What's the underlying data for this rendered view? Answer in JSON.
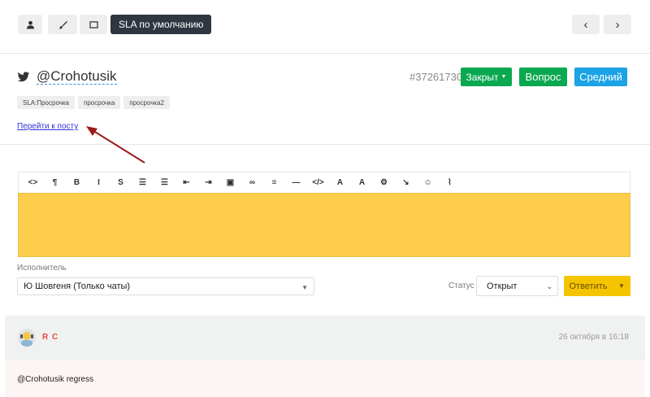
{
  "toolbar": {
    "sla_default_label": "SLA по умолчанию",
    "icons": [
      "user-icon",
      "brush-icon",
      "window-icon"
    ],
    "nav": {
      "prev": "‹",
      "next": "›"
    }
  },
  "ticket": {
    "handle": "@Crohotusik",
    "source_icon": "twitter-icon",
    "id": "#37261730",
    "status_button": "Закрыт",
    "type_button": "Вопрос",
    "priority_button": "Средний",
    "colors": {
      "closed": "#0aa84f",
      "question": "#0aa84f",
      "priority": "#1aa3e6"
    },
    "tags": [
      "SLA:Просрочка",
      "просрочка",
      "просрочка2"
    ],
    "post_link": "Перейти к посту"
  },
  "editor": {
    "tools": [
      {
        "name": "code-view-icon",
        "glyph": "<>"
      },
      {
        "name": "paragraph-icon",
        "glyph": "¶"
      },
      {
        "name": "bold-icon",
        "glyph": "B"
      },
      {
        "name": "italic-icon",
        "glyph": "I"
      },
      {
        "name": "strikethrough-icon",
        "glyph": "S"
      },
      {
        "name": "bullet-list-icon",
        "glyph": "☰"
      },
      {
        "name": "numbered-list-icon",
        "glyph": "☰"
      },
      {
        "name": "outdent-icon",
        "glyph": "⇤"
      },
      {
        "name": "indent-icon",
        "glyph": "⇥"
      },
      {
        "name": "image-icon",
        "glyph": "▣"
      },
      {
        "name": "link-icon",
        "glyph": "∞"
      },
      {
        "name": "align-icon",
        "glyph": "≡"
      },
      {
        "name": "horizontal-rule-icon",
        "glyph": "—"
      },
      {
        "name": "code-icon",
        "glyph": "</>"
      },
      {
        "name": "text-color-icon",
        "glyph": "A"
      },
      {
        "name": "background-color-icon",
        "glyph": "A"
      },
      {
        "name": "settings-icon",
        "glyph": "⚙"
      },
      {
        "name": "format-brush-icon",
        "glyph": "↘"
      },
      {
        "name": "emoji-icon",
        "glyph": "☺"
      },
      {
        "name": "attachment-icon",
        "glyph": "⌇"
      }
    ],
    "background": "#fecd4c"
  },
  "assignee": {
    "label": "Исполнитель",
    "value": "Ю Шовгеня (Только чаты)"
  },
  "status": {
    "label": "Статус",
    "value": "Открыт",
    "reply_button": "Ответить"
  },
  "message": {
    "author": "R C",
    "time": "26 октября в 16:18",
    "text": "@Crohotusik regress"
  }
}
